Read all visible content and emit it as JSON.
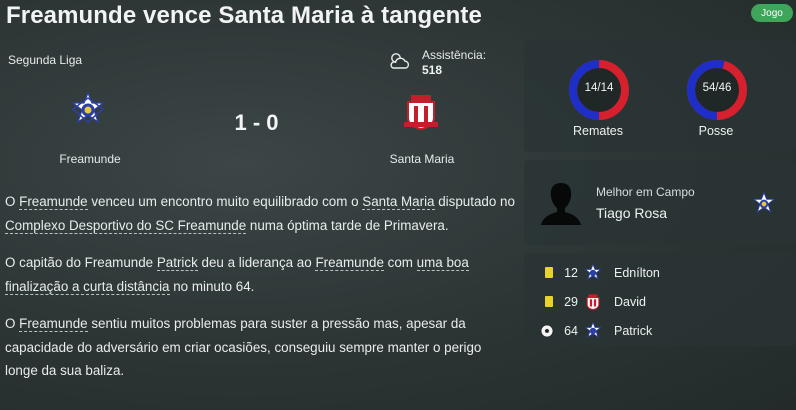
{
  "header": {
    "title": "Freamunde vence Santa Maria à tangente",
    "jogo_label": "Jogo"
  },
  "match": {
    "league": "Segunda Liga",
    "attendance_label": "Assistência:",
    "attendance_value": "518",
    "score": "1 - 0",
    "home": "Freamunde",
    "away": "Santa Maria",
    "weather_icon": "cloudy-icon"
  },
  "report": {
    "p1": {
      "t1": "O ",
      "l1": "Freamunde",
      "t2": " venceu um encontro muito equilibrado com o ",
      "l2": "Santa Maria",
      "t3": " disputado no ",
      "l3": "Complexo Desportivo do SC Freamunde",
      "t4": " numa óptima tarde de Primavera."
    },
    "p2": {
      "t1": "O capitão do Freamunde ",
      "l1": "Patrick",
      "t2": " deu a liderança ao ",
      "l2": "Freamunde",
      "t3": " com ",
      "l3": "uma boa finalização a curta distância",
      "t4": " no minuto 64."
    },
    "p3": {
      "t1": "O ",
      "l1": "Freamunde",
      "t2": " sentiu muitos problemas para suster a pressão mas, apesar da capacidade do adversário em criar ocasiões, conseguiu sempre manter o perigo longe da sua baliza."
    }
  },
  "stats": [
    {
      "label": "Remates",
      "value": "14/14",
      "home_share": 0.5
    },
    {
      "label": "Posse",
      "value": "54/46",
      "home_share": 0.54
    }
  ],
  "colors": {
    "home": "#1e2fc8",
    "away": "#d6202e",
    "accent_green": "#3fa55a",
    "card_yellow": "#e9d32a"
  },
  "motm": {
    "caption": "Melhor em Campo",
    "name": "Tiago Rosa"
  },
  "events": [
    {
      "type": "yellow-card",
      "minute": "12",
      "team": "home",
      "player": "Ednílton"
    },
    {
      "type": "yellow-card",
      "minute": "29",
      "team": "away",
      "player": "David"
    },
    {
      "type": "goal",
      "minute": "64",
      "team": "home",
      "player": "Patrick"
    }
  ]
}
